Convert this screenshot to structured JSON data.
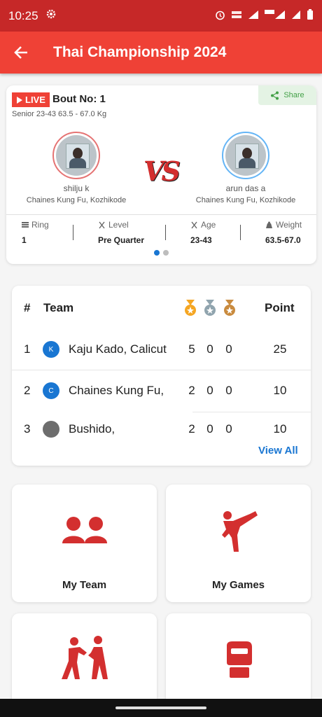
{
  "status_bar": {
    "time": "10:25"
  },
  "app_bar": {
    "title": "Thai Championship 2024"
  },
  "bout": {
    "live_label": "LIVE",
    "bout_label": "Bout No: 1",
    "category": "Senior 23-43 63.5 - 67.0 Kg",
    "share_label": "Share",
    "vs_text": "VS",
    "player_red": {
      "name": "shilju k",
      "club": "Chaines Kung Fu, Kozhikode"
    },
    "player_blue": {
      "name": "arun das a",
      "club": "Chaines Kung Fu, Kozhikode"
    },
    "stats": [
      {
        "label": "Ring",
        "value": "1",
        "icon": "ring-icon"
      },
      {
        "label": "Level",
        "value": "Pre Quarter",
        "icon": "level-icon"
      },
      {
        "label": "Age",
        "value": "23-43",
        "icon": "age-icon"
      },
      {
        "label": "Weight",
        "value": "63.5-67.0",
        "icon": "weight-icon"
      }
    ],
    "pager": {
      "pages": 2,
      "active": 1
    }
  },
  "leaderboard": {
    "headers": {
      "rank": "#",
      "team": "Team",
      "points": "Point"
    },
    "medal_colors": {
      "gold": "#f5a623",
      "silver": "#90a4ae",
      "bronze": "#c98b3f"
    },
    "rows": [
      {
        "rank": "1",
        "logo_letter": "K",
        "team": "Kaju Kado, Calicut",
        "gold": "5",
        "silver": "0",
        "bronze": "0",
        "points": "25"
      },
      {
        "rank": "2",
        "logo_letter": "C",
        "team": "Chaines Kung Fu,",
        "gold": "2",
        "silver": "0",
        "bronze": "0",
        "points": "10"
      },
      {
        "rank": "3",
        "logo_letter": "",
        "team": "Bushido,",
        "gold": "2",
        "silver": "0",
        "bronze": "0",
        "points": "10"
      }
    ],
    "view_all": "View All"
  },
  "tiles": [
    {
      "label": "My Team",
      "icon": "team-icon"
    },
    {
      "label": "My Games",
      "icon": "martial-arts-kick-icon"
    },
    {
      "label": "",
      "icon": "sparring-icon"
    },
    {
      "label": "",
      "icon": "boxing-glove-icon"
    }
  ],
  "colors": {
    "primary": "#ef4136",
    "status_bar": "#c62828",
    "accent_blue": "#1976d2",
    "icon_red": "#d32f2f"
  }
}
